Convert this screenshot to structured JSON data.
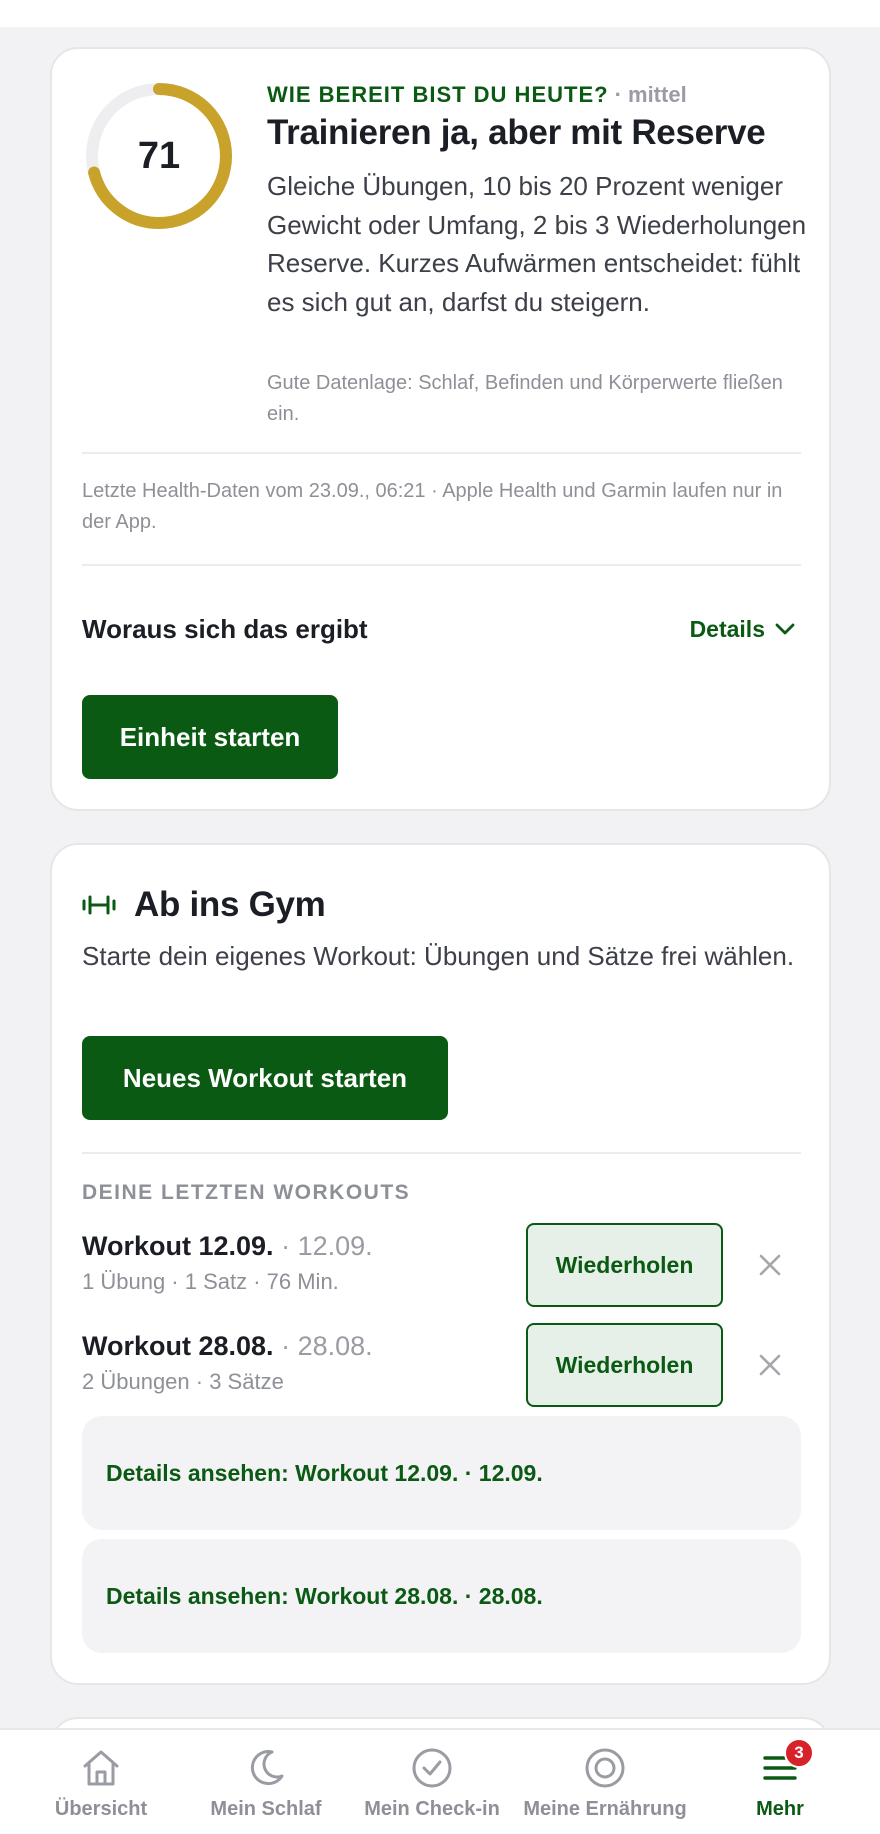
{
  "colors": {
    "brand_green": "#0b5a14",
    "gauge_gold": "#c9a22c",
    "badge_red": "#d8222a"
  },
  "readiness": {
    "score": "71",
    "score_fraction": 0.71,
    "eyebrow": "WIE BEREIT BIST DU HEUTE?",
    "level": "· mittel",
    "title": "Trainieren ja, aber mit Reserve",
    "body": "Gleiche Übungen, 10 bis 20 Prozent weniger Gewicht oder Umfang, 2 bis 3 Wiederholungen Reserve. Kurzes Aufwärmen entscheidet: fühlt es sich gut an, darfst du steigern.",
    "data_note": "Gute Datenlage: Schlaf, Befinden und Körperwerte fließen ein.",
    "health_note": "Letzte Health-Daten vom 23.09., 06:21 · Apple Health und Garmin laufen nur in der App.",
    "why_label": "Woraus sich das ergibt",
    "details_label": "Details",
    "start_button": "Einheit starten"
  },
  "gym": {
    "icon": "dumbbell-icon",
    "title": "Ab ins Gym",
    "description": "Starte dein eigenes Workout: Übungen und Sätze frei wählen.",
    "new_button": "Neues Workout starten",
    "recent_heading": "DEINE LETZTEN WORKOUTS",
    "workouts": [
      {
        "name": "Workout 12.09.",
        "date": "· 12.09.",
        "meta": "1 Übung · 1 Satz · 76 Min.",
        "repeat_label": "Wiederholen"
      },
      {
        "name": "Workout 28.08.",
        "date": "· 28.08.",
        "meta": "2 Übungen · 3 Sätze",
        "repeat_label": "Wiederholen"
      }
    ],
    "detail_links": [
      "Details ansehen: Workout 12.09. · 12.09.",
      "Details ansehen: Workout 28.08. · 28.08."
    ]
  },
  "nav": {
    "items": [
      {
        "label": "Übersicht",
        "icon": "home-icon"
      },
      {
        "label": "Mein Schlaf",
        "icon": "moon-icon"
      },
      {
        "label": "Mein Check-in",
        "icon": "check-circle-icon"
      },
      {
        "label": "Meine Ernährung",
        "icon": "target-icon"
      },
      {
        "label": "Mehr",
        "icon": "menu-icon",
        "badge": "3",
        "active": true
      }
    ]
  }
}
